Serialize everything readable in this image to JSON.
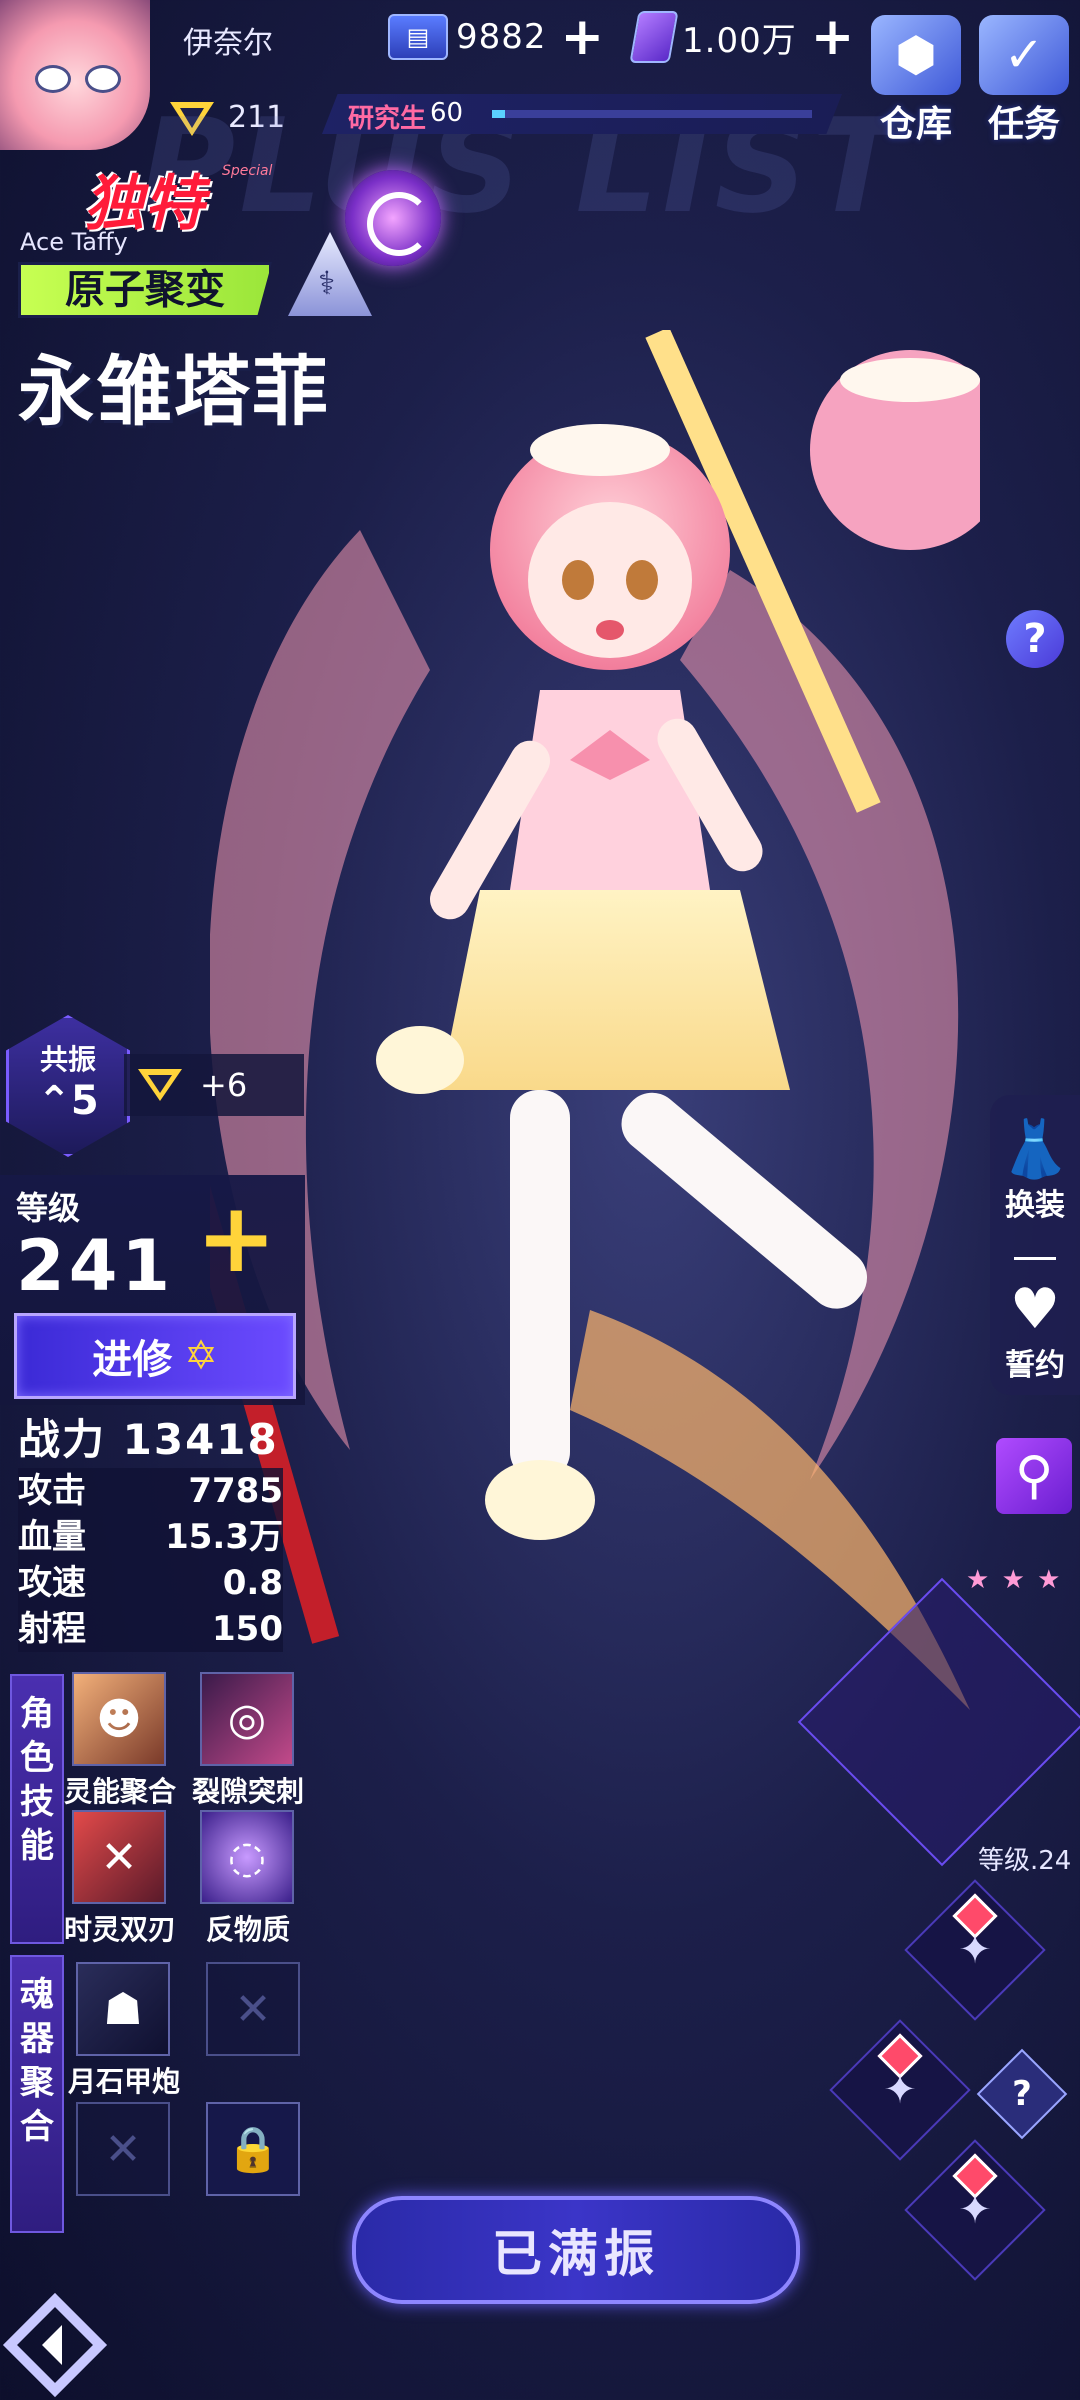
{
  "topbar": {
    "player_name": "伊奈尔",
    "rank_value": "211",
    "currency1": "9882",
    "currency2": "1.00万",
    "plus": "+",
    "warehouse_label": "仓库",
    "mission_label": "任务",
    "title_label": "研究生",
    "title_level": "60",
    "xp_progress": 0.04
  },
  "character": {
    "rarity": "独特",
    "rarity_sub": "Special",
    "english_name": "Ace Taffy",
    "class": "原子聚变",
    "name": "永雏塔菲",
    "resonance_label": "共振",
    "resonance_value": "5",
    "resonance_bonus": "+6"
  },
  "level": {
    "label": "等级",
    "value": "241",
    "plus": "+",
    "advance_label": "进修"
  },
  "stats": {
    "power_label": "战力",
    "power_value": "13418",
    "rows": [
      {
        "label": "攻击",
        "value": "7785"
      },
      {
        "label": "血量",
        "value": "15.3万"
      },
      {
        "label": "攻速",
        "value": "0.8"
      },
      {
        "label": "射程",
        "value": "150"
      }
    ]
  },
  "skills": {
    "tab_label": "角色技能",
    "items": [
      {
        "name": "灵能聚合",
        "icon": "figure-icon"
      },
      {
        "name": "裂隙突刺",
        "icon": "vortex-icon"
      },
      {
        "name": "时灵双刃",
        "icon": "blades-icon"
      },
      {
        "name": "反物质",
        "icon": "swirl-icon"
      }
    ]
  },
  "soul": {
    "tab_label": "魂器聚合",
    "equipped_name": "月石甲炮"
  },
  "right": {
    "help": "?",
    "dress_label": "换装",
    "vow_label": "誓约",
    "weapon_level": "等级.24"
  },
  "bottom": {
    "max_label": "已满振"
  },
  "colors": {
    "accent": "#6c4bff",
    "rarity": "#ff1b3a",
    "class_tag": "#c7ff52",
    "level_plus": "#ffd43a"
  }
}
